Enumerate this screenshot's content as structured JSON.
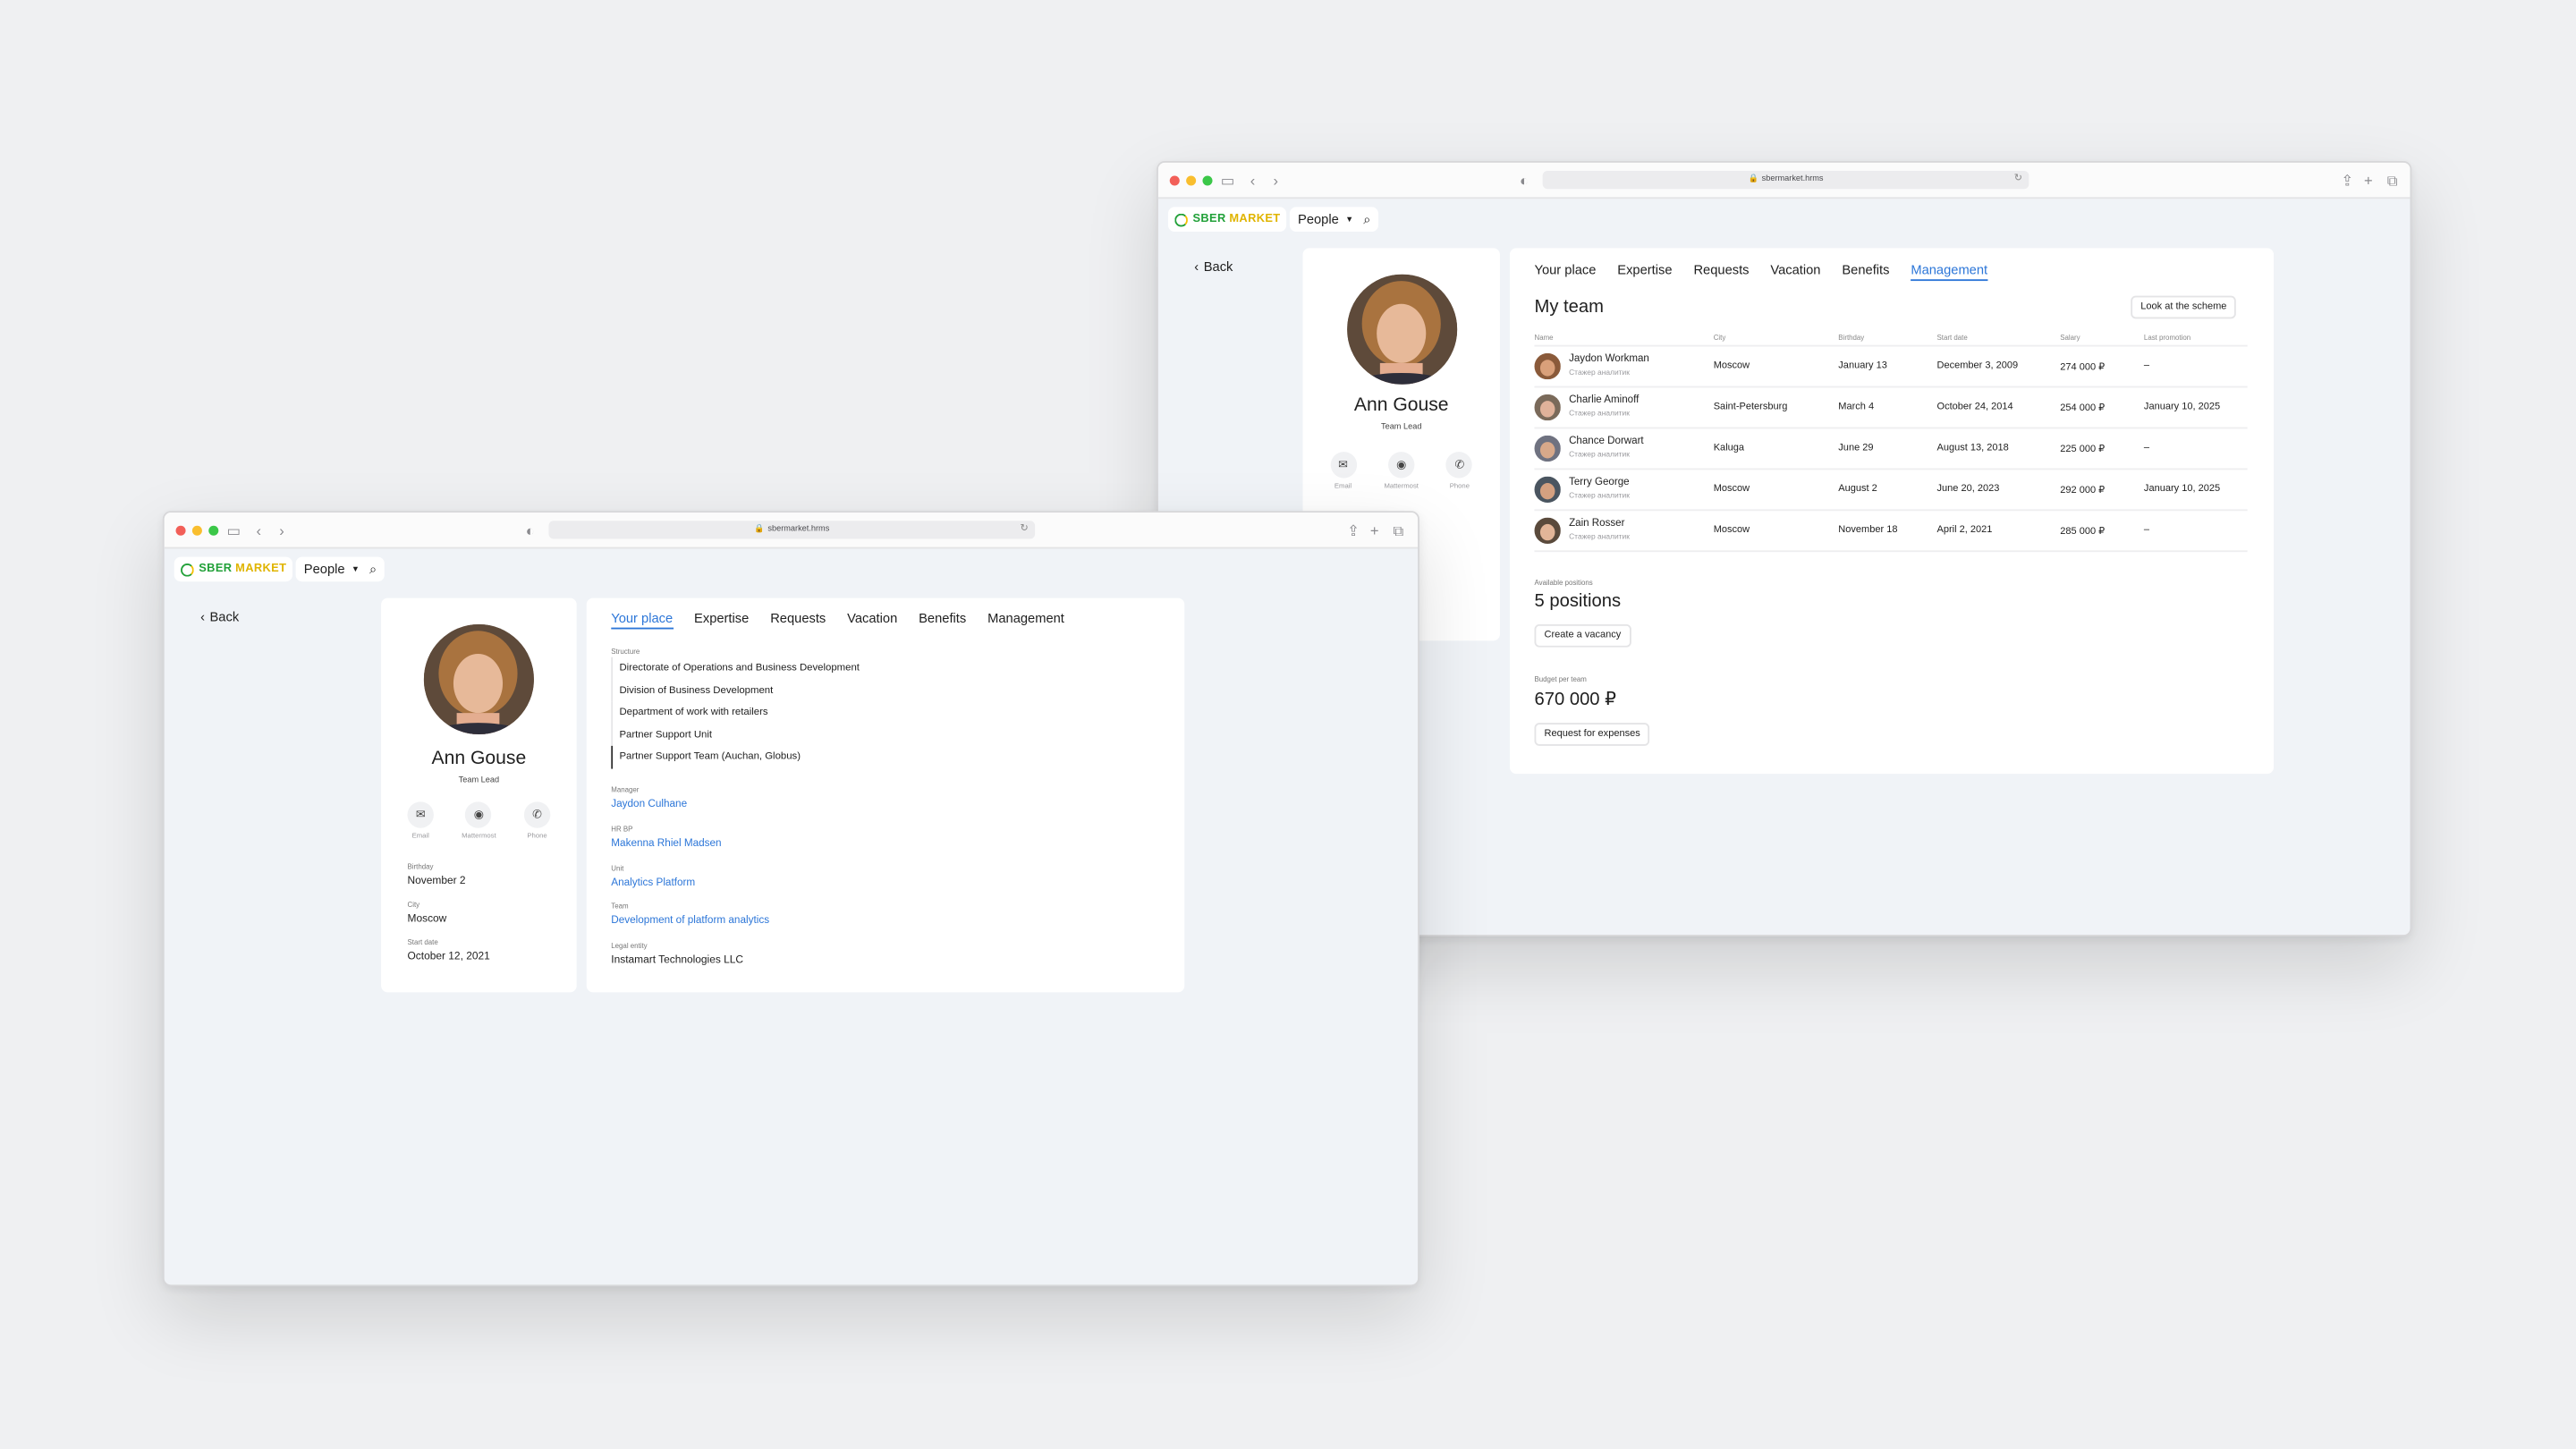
{
  "browser_front": {
    "url": "sbermarket.hrms"
  },
  "browser_back": {
    "url": "sbermarket.hrms"
  },
  "brand": {
    "part1": "SBER",
    "part2": "MARKET"
  },
  "nav": {
    "people_label": "People",
    "back_label": "Back"
  },
  "profile": {
    "name": "Ann Gouse",
    "role": "Team Lead",
    "contacts": [
      {
        "label": "Email",
        "icon": "mail-icon"
      },
      {
        "label": "Mattermost",
        "icon": "mattermost-icon"
      },
      {
        "label": "Phone",
        "icon": "phone-icon"
      }
    ],
    "fields": [
      {
        "label": "Birthday",
        "value": "November 2"
      },
      {
        "label": "City",
        "value": "Moscow"
      },
      {
        "label": "Start date",
        "value": "October 12, 2021"
      }
    ]
  },
  "tabs": [
    "Your place",
    "Expertise",
    "Requests",
    "Vacation",
    "Benefits",
    "Management"
  ],
  "your_place": {
    "structure_label": "Structure",
    "structure": [
      "Directorate of Operations and Business Development",
      "Division of Business Development",
      "Department of work with retailers",
      "Partner Support Unit",
      "Partner Support Team (Auchan, Globus)"
    ],
    "manager_label": "Manager",
    "manager": "Jaydon Culhane",
    "hrbp_label": "HR BP",
    "hrbp": "Makenna Rhiel Madsen",
    "unit_label": "Unit",
    "unit": "Analytics Platform",
    "team_label": "Team",
    "team": "Development of platform analytics",
    "legal_label": "Legal entity",
    "legal": "Instamart Technologies LLC"
  },
  "management": {
    "title": "My team",
    "scheme_button": "Look at the scheme",
    "columns": [
      "Name",
      "City",
      "Birthday",
      "Start date",
      "Salary",
      "Last promotion"
    ],
    "rows": [
      {
        "name": "Jaydon Workman",
        "sub": "Стажер аналитик",
        "city": "Moscow",
        "birthday": "January 13",
        "start": "December 3, 2009",
        "salary": "274 000 ₽",
        "promotion": "–"
      },
      {
        "name": "Charlie Aminoff",
        "sub": "Стажер аналитик",
        "city": "Saint-Petersburg",
        "birthday": "March 4",
        "start": "October 24, 2014",
        "salary": "254 000 ₽",
        "promotion": "January 10, 2025"
      },
      {
        "name": "Chance Dorwart",
        "sub": "Стажер аналитик",
        "city": "Kaluga",
        "birthday": "June 29",
        "start": "August 13, 2018",
        "salary": "225 000 ₽",
        "promotion": "–"
      },
      {
        "name": "Terry George",
        "sub": "Стажер аналитик",
        "city": "Moscow",
        "birthday": "August 2",
        "start": "June 20, 2023",
        "salary": "292 000 ₽",
        "promotion": "January 10, 2025"
      },
      {
        "name": "Zain Rosser",
        "sub": "Стажер аналитик",
        "city": "Moscow",
        "birthday": "November 18",
        "start": "April 2, 2021",
        "salary": "285 000 ₽",
        "promotion": "–"
      }
    ],
    "positions_label": "Available positions",
    "positions": "5 positions",
    "vacancy_button": "Create a vacancy",
    "budget_label": "Budget per team",
    "budget": "670 000 ₽",
    "expenses_button": "Request for expenses"
  }
}
